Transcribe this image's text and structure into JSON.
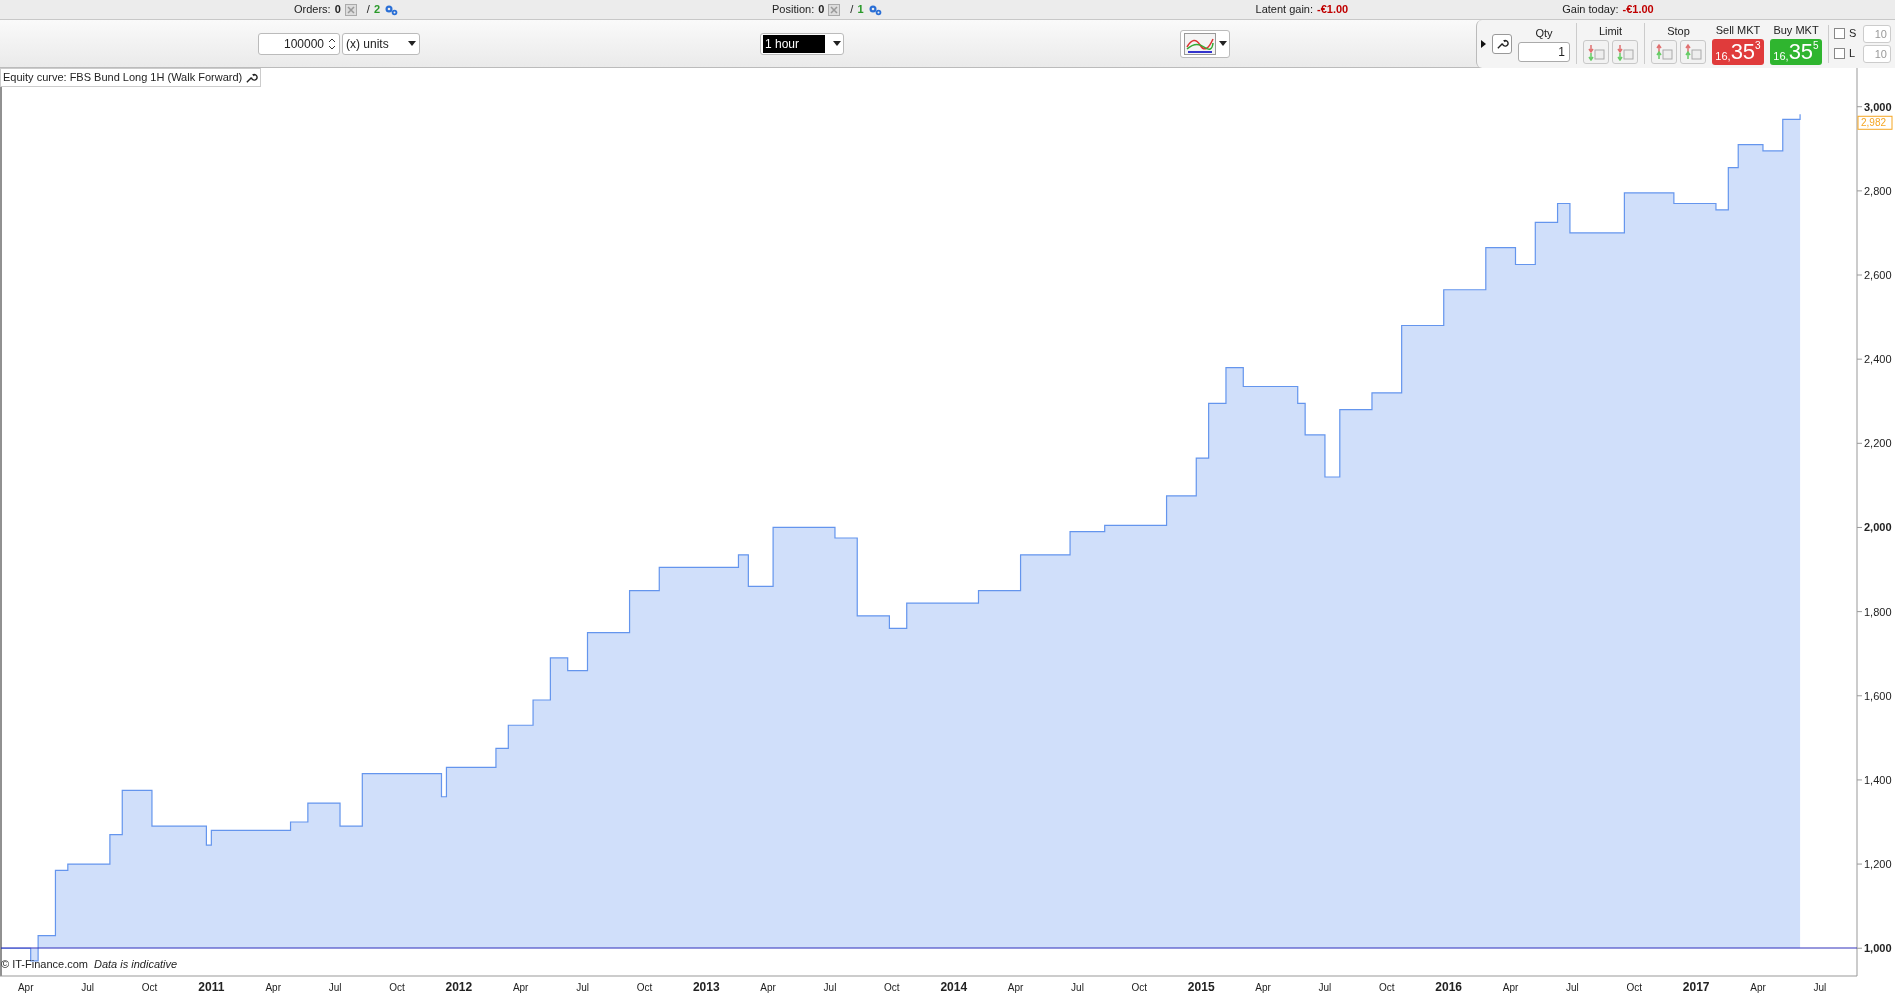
{
  "status_bar": [
    {
      "label": "Orders:",
      "value": "0",
      "separator": "/",
      "count": "2",
      "kind": "count"
    },
    {
      "label": "Position:",
      "value": "0",
      "separator": "/",
      "count": "1",
      "kind": "count"
    },
    {
      "label": "Latent gain:",
      "value": "-€1.00",
      "kind": "money"
    },
    {
      "label": "Gain today:",
      "value": "-€1.00",
      "kind": "money"
    }
  ],
  "toolbar": {
    "quantity": "100000",
    "unit": "(x) units",
    "interval": "1 hour"
  },
  "order_panel": {
    "qty_label": "Qty",
    "qty": "1",
    "limit_label": "Limit",
    "stop_label": "Stop",
    "sell": {
      "label": "Sell MKT",
      "prefix": "16,",
      "main": "35",
      "sup": "3"
    },
    "buy": {
      "label": "Buy MKT",
      "prefix": "16,",
      "main": "35",
      "sup": "5"
    },
    "stops": [
      {
        "label": "S",
        "checked": false,
        "placeholder": "10"
      },
      {
        "label": "L",
        "checked": false,
        "placeholder": "10"
      }
    ]
  },
  "chart": {
    "title": "Equity curve: FBS Bund Long 1H (Walk Forward)",
    "copyright": "© IT-Finance.com",
    "note": "Data is indicative",
    "last_value": "2,982",
    "chart_data": {
      "type": "area",
      "x": [
        2010.15,
        2010.27,
        2010.3,
        2010.37,
        2010.42,
        2010.59,
        2010.64,
        2010.74,
        2010.76,
        2010.98,
        2011.0,
        2011.32,
        2011.39,
        2011.52,
        2011.61,
        2011.76,
        2011.93,
        2011.95,
        2012.15,
        2012.2,
        2012.3,
        2012.37,
        2012.44,
        2012.52,
        2012.69,
        2012.78,
        2012.81,
        2013.13,
        2013.17,
        2013.27,
        2013.52,
        2013.61,
        2013.74,
        2013.81,
        2014.03,
        2014.1,
        2014.27,
        2014.47,
        2014.61,
        2014.86,
        2014.98,
        2015.03,
        2015.1,
        2015.17,
        2015.39,
        2015.42,
        2015.5,
        2015.56,
        2015.69,
        2015.81,
        2015.98,
        2016.15,
        2016.27,
        2016.35,
        2016.44,
        2016.49,
        2016.64,
        2016.71,
        2016.86,
        2016.91,
        2017.08,
        2017.13,
        2017.17,
        2017.27,
        2017.35,
        2017.42
      ],
      "series": [
        {
          "color": "#6495ed",
          "values": [
            1000,
            970,
            1030,
            1185,
            1200,
            1270,
            1375,
            1375,
            1290,
            1245,
            1280,
            1300,
            1345,
            1290,
            1415,
            1415,
            1360,
            1430,
            1475,
            1530,
            1590,
            1690,
            1660,
            1750,
            1850,
            1850,
            1905,
            1935,
            1860,
            2000,
            1975,
            1790,
            1760,
            1820,
            1820,
            1850,
            1935,
            1990,
            2005,
            2075,
            2165,
            2295,
            2380,
            2335,
            2295,
            2220,
            2120,
            2280,
            2320,
            2480,
            2565,
            2665,
            2625,
            2725,
            2770,
            2700,
            2700,
            2795,
            2795,
            2770,
            2755,
            2855,
            2910,
            2895,
            2970,
            2982
          ]
        }
      ],
      "xlim": [
        2010.15,
        2017.65
      ],
      "ylim": [
        934,
        3092
      ],
      "xticks": [
        {
          "value": 2010.25,
          "label": "Apr"
        },
        {
          "value": 2010.5,
          "label": "Jul"
        },
        {
          "value": 2010.75,
          "label": "Oct"
        },
        {
          "value": 2011,
          "label": "2011"
        },
        {
          "value": 2011.25,
          "label": "Apr"
        },
        {
          "value": 2011.5,
          "label": "Jul"
        },
        {
          "value": 2011.75,
          "label": "Oct"
        },
        {
          "value": 2012,
          "label": "2012"
        },
        {
          "value": 2012.25,
          "label": "Apr"
        },
        {
          "value": 2012.5,
          "label": "Jul"
        },
        {
          "value": 2012.75,
          "label": "Oct"
        },
        {
          "value": 2013,
          "label": "2013"
        },
        {
          "value": 2013.25,
          "label": "Apr"
        },
        {
          "value": 2013.5,
          "label": "Jul"
        },
        {
          "value": 2013.75,
          "label": "Oct"
        },
        {
          "value": 2014,
          "label": "2014"
        },
        {
          "value": 2014.25,
          "label": "Apr"
        },
        {
          "value": 2014.5,
          "label": "Jul"
        },
        {
          "value": 2014.75,
          "label": "Oct"
        },
        {
          "value": 2015,
          "label": "2015"
        },
        {
          "value": 2015.25,
          "label": "Apr"
        },
        {
          "value": 2015.5,
          "label": "Jul"
        },
        {
          "value": 2015.75,
          "label": "Oct"
        },
        {
          "value": 2016,
          "label": "2016"
        },
        {
          "value": 2016.25,
          "label": "Apr"
        },
        {
          "value": 2016.5,
          "label": "Jul"
        },
        {
          "value": 2016.75,
          "label": "Oct"
        },
        {
          "value": 2017,
          "label": "2017"
        },
        {
          "value": 2017.25,
          "label": "Apr"
        },
        {
          "value": 2017.5,
          "label": "Jul"
        }
      ],
      "yticks": [
        {
          "value": 1000,
          "label": "1,000"
        },
        {
          "value": 1200,
          "label": "1,200"
        },
        {
          "value": 1400,
          "label": "1,400"
        },
        {
          "value": 1600,
          "label": "1,600"
        },
        {
          "value": 1800,
          "label": "1,800"
        },
        {
          "value": 2000,
          "label": "2,000"
        },
        {
          "value": 2200,
          "label": "2,200"
        },
        {
          "value": 2400,
          "label": "2,400"
        },
        {
          "value": 2600,
          "label": "2,600"
        },
        {
          "value": 2800,
          "label": "2,800"
        },
        {
          "value": 3000,
          "label": "3,000"
        }
      ]
    }
  }
}
